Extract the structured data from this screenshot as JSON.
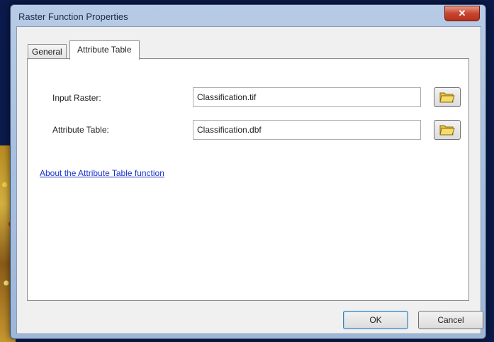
{
  "window": {
    "title": "Raster Function Properties",
    "close_glyph": "✕"
  },
  "tabs": [
    {
      "label": "General",
      "active": false
    },
    {
      "label": "Attribute Table",
      "active": true
    }
  ],
  "form": {
    "input_raster": {
      "label": "Input Raster:",
      "value": "Classification.tif",
      "browse_icon": "open-folder-icon"
    },
    "attribute_table": {
      "label": "Attribute Table:",
      "value": "Classification.dbf",
      "browse_icon": "open-folder-icon"
    }
  },
  "help_link": "About the Attribute Table function",
  "buttons": {
    "ok": "OK",
    "cancel": "Cancel"
  },
  "colors": {
    "link": "#1a33cc",
    "close": "#c84530",
    "title_bar": "#a9c1e0"
  }
}
